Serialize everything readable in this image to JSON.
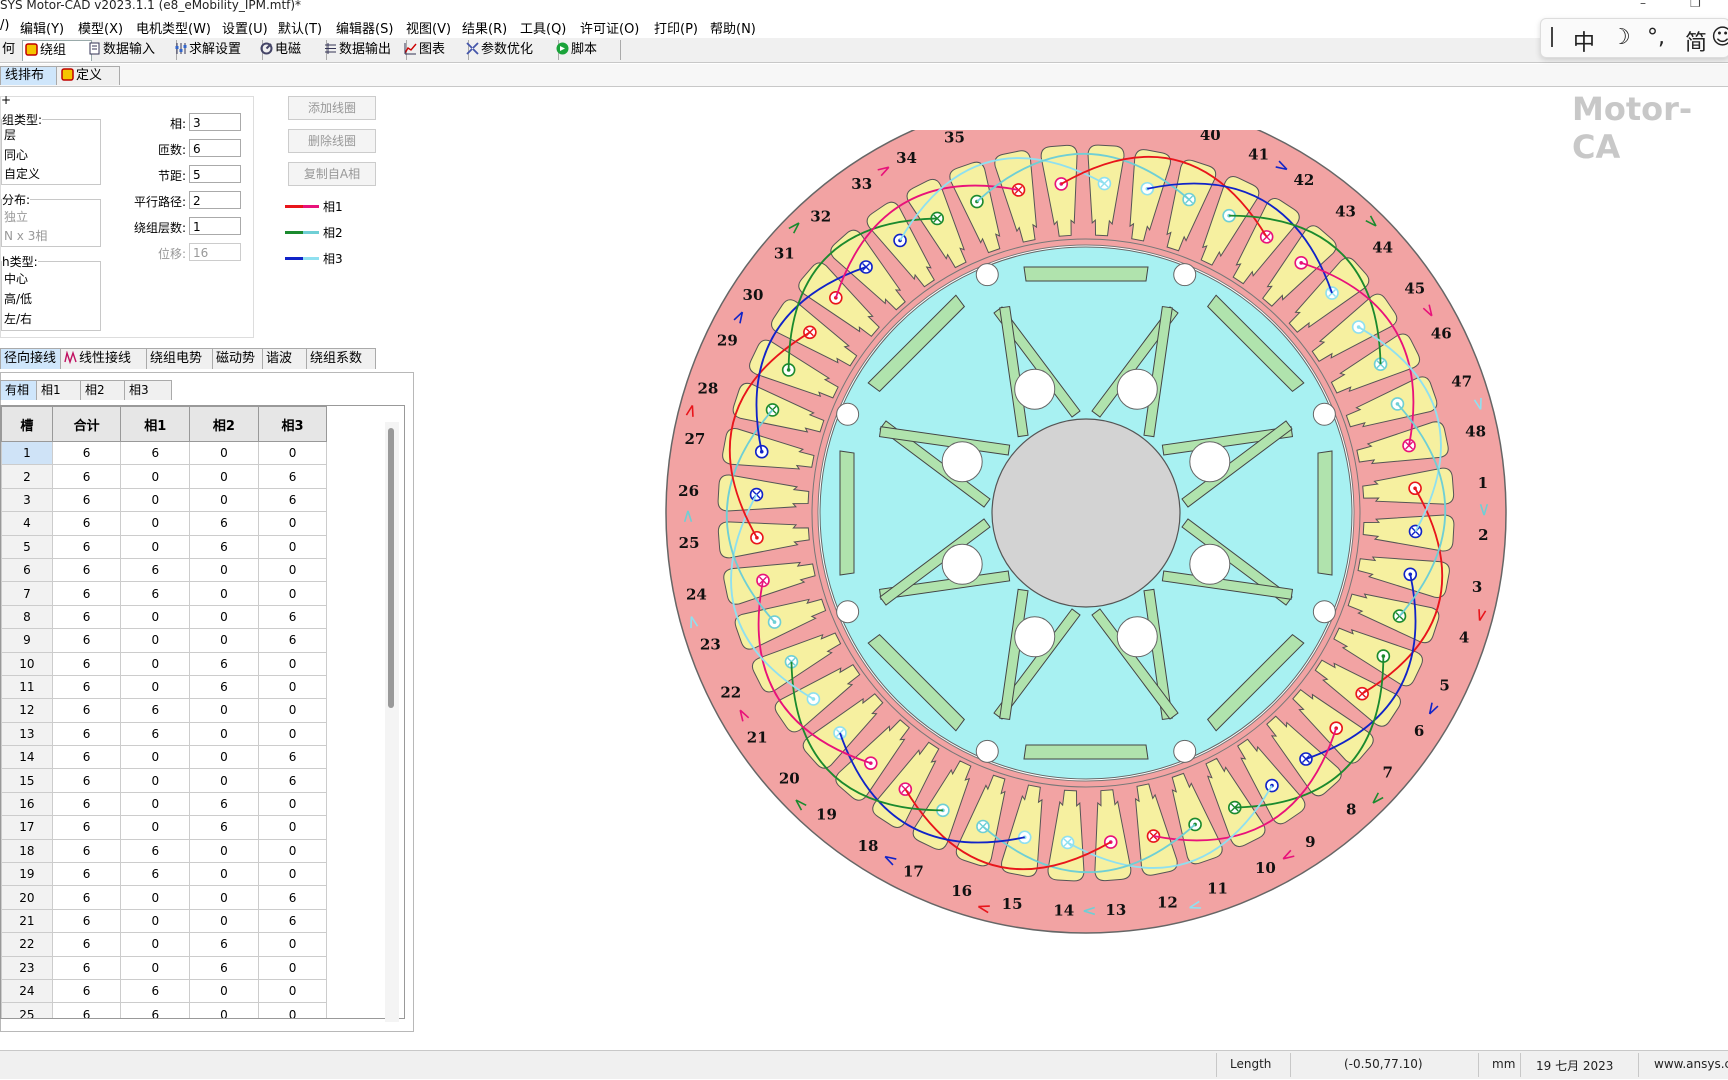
{
  "title_bar": {
    "title": "SYS Motor-CAD v2023.1.1 (e8_eMobility_IPM.mtf)*",
    "minimize": "–",
    "restore": "❐"
  },
  "menu": [
    "/)",
    "编辑(Y)",
    "模型(X)",
    "电机类型(W)",
    "设置(U)",
    "默认(T)",
    "编辑器(S)",
    "视图(V)",
    "结果(R)",
    "工具(Q)",
    "许可证(O)",
    "打印(P)",
    "帮助(N)"
  ],
  "main_tabs": [
    {
      "label": "何"
    },
    {
      "label": "绕组",
      "active": true
    },
    {
      "label": "数据输入"
    },
    {
      "label": "求解设置"
    },
    {
      "label": "电磁"
    },
    {
      "label": "数据输出"
    },
    {
      "label": "图表"
    },
    {
      "label": "参数优化"
    },
    {
      "label": "脚本"
    }
  ],
  "sub_tabs": [
    {
      "label": "线排布",
      "active": true
    },
    {
      "label": "定义"
    }
  ],
  "settings": {
    "corner_mark": "+",
    "winding_type": {
      "label": "组类型:",
      "items": [
        "层",
        "同心",
        "自定义"
      ]
    },
    "distribution": {
      "label": "分布:",
      "items": [
        "独立",
        "N x 3相"
      ]
    },
    "path_type": {
      "label": "h类型:",
      "items": [
        "中心",
        "高/低",
        "左/右"
      ]
    },
    "fields": [
      {
        "label": "相:",
        "value": "3",
        "disabled": false
      },
      {
        "label": "匝数:",
        "value": "6",
        "disabled": false
      },
      {
        "label": "节距:",
        "value": "5",
        "disabled": false
      },
      {
        "label": "平行路径:",
        "value": "2",
        "disabled": false
      },
      {
        "label": "绕组层数:",
        "value": "1",
        "disabled": false
      },
      {
        "label": "位移:",
        "value": "16",
        "disabled": true
      }
    ],
    "buttons": [
      "添加线圈",
      "删除线圈",
      "复制自A相"
    ],
    "legend": [
      {
        "label": "相1",
        "c1": "#e8151b",
        "c2": "#e8127a"
      },
      {
        "label": "相2",
        "c1": "#1b8a2e",
        "c2": "#6fcfd5"
      },
      {
        "label": "相3",
        "c1": "#1023c8",
        "c2": "#8fe0f0"
      }
    ]
  },
  "lower_tabs": [
    {
      "label": "径向接线",
      "active": true
    },
    {
      "label": "线性接线"
    },
    {
      "label": "绕组电势"
    },
    {
      "label": "磁动势"
    },
    {
      "label": "谐波"
    },
    {
      "label": "绕组系数"
    }
  ],
  "phase_tabs": [
    {
      "label": "有相",
      "active": true
    },
    {
      "label": "相1"
    },
    {
      "label": "相2"
    },
    {
      "label": "相3"
    }
  ],
  "table": {
    "headers": [
      "槽",
      "合计",
      "相1",
      "相2",
      "相3"
    ],
    "rows": [
      [
        "1",
        "6",
        "6",
        "0",
        "0"
      ],
      [
        "2",
        "6",
        "0",
        "0",
        "6"
      ],
      [
        "3",
        "6",
        "0",
        "0",
        "6"
      ],
      [
        "4",
        "6",
        "0",
        "6",
        "0"
      ],
      [
        "5",
        "6",
        "0",
        "6",
        "0"
      ],
      [
        "6",
        "6",
        "6",
        "0",
        "0"
      ],
      [
        "7",
        "6",
        "6",
        "0",
        "0"
      ],
      [
        "8",
        "6",
        "0",
        "0",
        "6"
      ],
      [
        "9",
        "6",
        "0",
        "0",
        "6"
      ],
      [
        "10",
        "6",
        "0",
        "6",
        "0"
      ],
      [
        "11",
        "6",
        "0",
        "6",
        "0"
      ],
      [
        "12",
        "6",
        "6",
        "0",
        "0"
      ],
      [
        "13",
        "6",
        "6",
        "0",
        "0"
      ],
      [
        "14",
        "6",
        "0",
        "0",
        "6"
      ],
      [
        "15",
        "6",
        "0",
        "0",
        "6"
      ],
      [
        "16",
        "6",
        "0",
        "6",
        "0"
      ],
      [
        "17",
        "6",
        "0",
        "6",
        "0"
      ],
      [
        "18",
        "6",
        "6",
        "0",
        "0"
      ],
      [
        "19",
        "6",
        "6",
        "0",
        "0"
      ],
      [
        "20",
        "6",
        "0",
        "0",
        "6"
      ],
      [
        "21",
        "6",
        "0",
        "0",
        "6"
      ],
      [
        "22",
        "6",
        "0",
        "6",
        "0"
      ],
      [
        "23",
        "6",
        "0",
        "6",
        "0"
      ],
      [
        "24",
        "6",
        "6",
        "0",
        "0"
      ],
      [
        "25",
        "6",
        "6",
        "0",
        "0"
      ]
    ]
  },
  "watermark": "Motor-CA",
  "ime": {
    "items": [
      "中",
      "☽",
      "°,",
      "简",
      "☺"
    ]
  },
  "status": {
    "length_label": "Length",
    "coords": "(-0.50,77.10)",
    "unit": "mm",
    "date": "19 七月 2023",
    "website": "www.ansys.co"
  },
  "diagram": {
    "slot_count": 48,
    "colors": {
      "stator": "#f2a3a3",
      "slot": "#f6f0a0",
      "rotor": "#a8f1f2",
      "magnet": "#b0e3ad",
      "shaft": "#d3d3d3",
      "phase1_a": "#e8151b",
      "phase1_b": "#e8127a",
      "phase2_a": "#1b8a2e",
      "phase2_b": "#6fcfd5",
      "phase3_a": "#1023c8",
      "phase3_b": "#8fe0f0"
    }
  }
}
